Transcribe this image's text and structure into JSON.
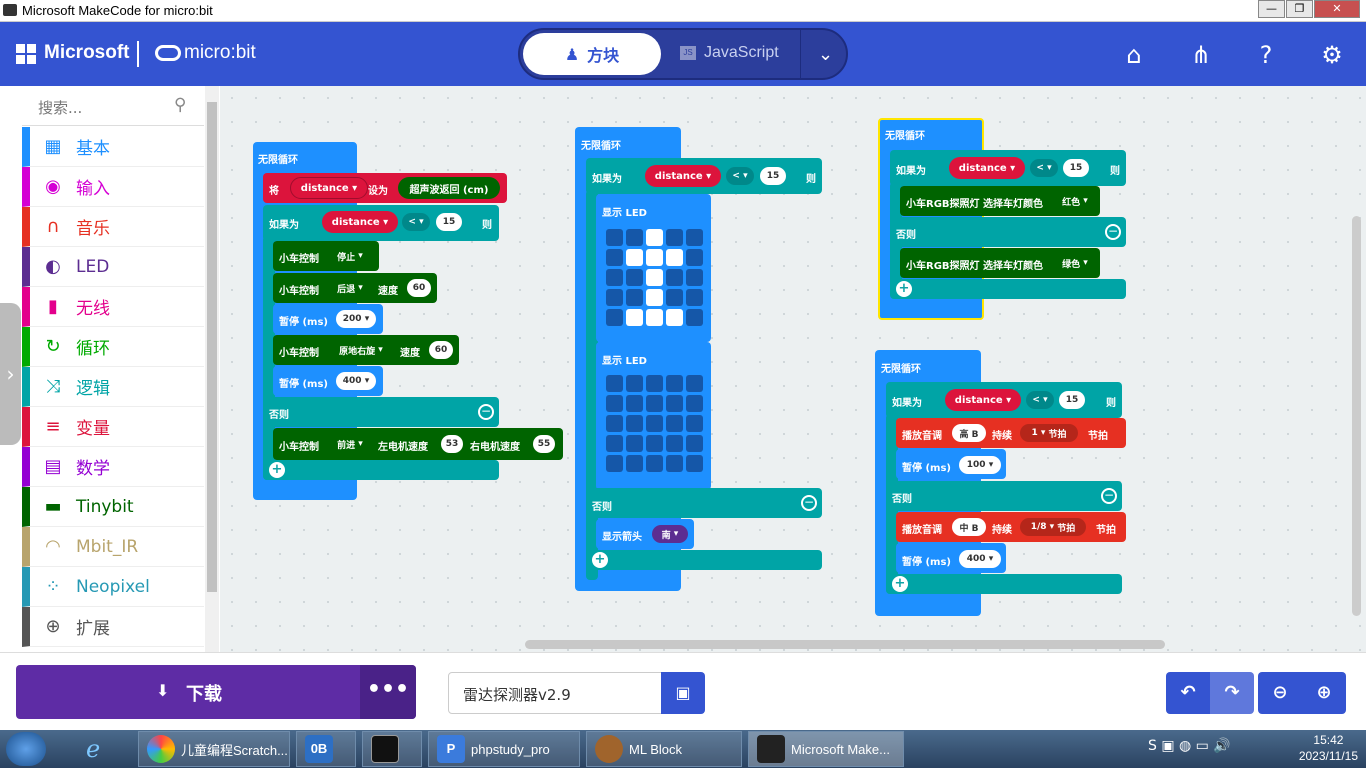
{
  "window": {
    "title": "Microsoft MakeCode for micro:bit",
    "btns": [
      "—",
      "❐",
      "✕"
    ]
  },
  "header": {
    "brand": "Microsoft",
    "product": "micro:bit",
    "tab_blocks": "方块",
    "tab_js": "JavaScript",
    "js_badge": "JS"
  },
  "sidebar": {
    "search_placeholder": "搜索...",
    "categories": [
      {
        "label": "基本",
        "color": "#1e90ff",
        "icon": "grid-icon"
      },
      {
        "label": "输入",
        "color": "#d400d4",
        "icon": "target-icon"
      },
      {
        "label": "音乐",
        "color": "#e63022",
        "icon": "headphones-icon"
      },
      {
        "label": "LED",
        "color": "#5c2d91",
        "icon": "toggle-icon"
      },
      {
        "label": "无线",
        "color": "#e3008c",
        "icon": "signal-icon"
      },
      {
        "label": "循环",
        "color": "#00aa00",
        "icon": "loop-icon"
      },
      {
        "label": "逻辑",
        "color": "#00a4a6",
        "icon": "shuffle-icon"
      },
      {
        "label": "变量",
        "color": "#dc143c",
        "icon": "list-icon"
      },
      {
        "label": "数学",
        "color": "#9400d3",
        "icon": "calculator-icon"
      },
      {
        "label": "Tinybit",
        "color": "#006400",
        "icon": "car-icon"
      },
      {
        "label": "Mbit_IR",
        "color": "#b8a46c",
        "icon": "wifi-icon"
      },
      {
        "label": "Neopixel",
        "color": "#2699b4",
        "icon": "dots-icon"
      },
      {
        "label": "扩展",
        "color": "#555555",
        "icon": "plus-icon"
      }
    ]
  },
  "blocks": {
    "forever": "无限循环",
    "set": "将",
    "var": "distance",
    "set_to": "设为",
    "ultra": "超声波返回 (cm)",
    "if": "如果为",
    "lt": "<",
    "fifteen": "15",
    "then": "则",
    "else": "否则",
    "car": "小车控制",
    "stop": "停止",
    "back": "后退",
    "speed": "速度",
    "v60": "60",
    "pause": "暂停 (ms)",
    "v200": "200",
    "spin": "原地右旋",
    "v400": "400",
    "fwd": "前进",
    "lspeed": "左电机速度",
    "v53": "53",
    "rspeed": "右电机速度",
    "v55": "55",
    "showled": "显示 LED",
    "arrow": "显示箭头",
    "south": "南",
    "rgb": "小车RGB探照灯 选择车灯颜色",
    "red": "红色",
    "green": "绿色",
    "tone": "播放音调",
    "highB": "高 B",
    "for": "持续",
    "beat1": "1",
    "beats": "节拍",
    "midB": "中 B",
    "beat18": "1/8",
    "v100": "100"
  },
  "led1": [
    0,
    0,
    1,
    0,
    0,
    0,
    1,
    1,
    1,
    0,
    0,
    0,
    1,
    0,
    0,
    0,
    0,
    1,
    0,
    0,
    0,
    1,
    1,
    1,
    0
  ],
  "led2": [
    0,
    0,
    0,
    0,
    0,
    0,
    0,
    0,
    0,
    0,
    0,
    0,
    0,
    0,
    0,
    0,
    0,
    0,
    0,
    0,
    0,
    0,
    0,
    0,
    0
  ],
  "bottom": {
    "download": "下载",
    "more": "•••",
    "project": "雷达探测器v2.9"
  },
  "taskbar": {
    "items": [
      "儿童编程Scratch...",
      "phpstudy_pro",
      "ML Block",
      "Microsoft Make..."
    ],
    "time": "15:42",
    "date": "2023/11/15"
  }
}
